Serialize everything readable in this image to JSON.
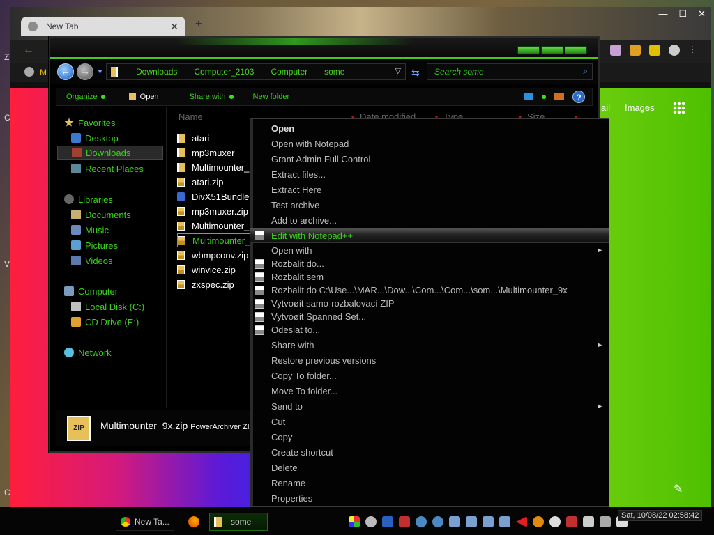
{
  "chrome": {
    "tab_title": "New Tab",
    "tab_close": "✕",
    "new_tab": "+",
    "win_min": "—",
    "win_max": "☐",
    "win_close": "✕",
    "back": "←",
    "bookmark_initial": "M",
    "gmail": "ail",
    "images": "Images",
    "pencil": "✎",
    "side_chars": [
      "Z",
      "C",
      "V",
      "C"
    ]
  },
  "explorer": {
    "breadcrumb": [
      "Downloads",
      "Computer_2103",
      "Computer",
      "some"
    ],
    "address_dropdown": "▽",
    "refresh": "⇆",
    "search_placeholder": "Search some",
    "search_icon": "⌕",
    "commands": {
      "organize": "Organize",
      "open": "Open",
      "share_with": "Share with",
      "new_folder": "New folder",
      "help": "?"
    },
    "columns": {
      "name": "Name",
      "date": "Date modified",
      "type": "Type",
      "size": "Size"
    },
    "nav": {
      "favorites": "Favorites",
      "desktop": "Desktop",
      "downloads": "Downloads",
      "recent": "Recent Places",
      "libraries": "Libraries",
      "documents": "Documents",
      "music": "Music",
      "pictures": "Pictures",
      "videos": "Videos",
      "computer": "Computer",
      "local_disk": "Local Disk (C:)",
      "cd_drive": "CD Drive (E:)",
      "network": "Network"
    },
    "files": [
      "atari",
      "mp3muxer",
      "Multimounter_",
      "atari.zip",
      "DivX51Bundle.",
      "mp3muxer.zip",
      "Multimounter_",
      "Multimounter_",
      "wbmpconv.zip",
      "winvice.zip",
      "zxspec.zip"
    ],
    "details": {
      "name": "Multimounter_9x.zip",
      "type": "PowerArchiver ZI",
      "icon_text": "ZIP"
    }
  },
  "context_menu": {
    "items": [
      "Open",
      "Open with Notepad",
      "Grant Admin Full Control",
      "Extract files...",
      "Extract Here",
      "Test archive",
      "Add to archive...",
      "Edit with Notepad++",
      "Open with",
      "Rozbalit do...",
      "Rozbalit sem",
      "Rozbalit do C:\\Use...\\MAR...\\Dow...\\Com...\\Com...\\som...\\Multimounter_9x",
      "Vytvoøit samo-rozbalovací ZIP",
      "Vytvoøit Spanned Set...",
      "Odeslat to...",
      "Share with",
      "Restore previous versions",
      "Copy To folder...",
      "Move To folder...",
      "Send to",
      "Cut",
      "Copy",
      "Create shortcut",
      "Delete",
      "Rename",
      "Properties"
    ],
    "submenu_arrow": "►"
  },
  "taskbar": {
    "chrome_label": "New Ta...",
    "explorer_label": "some",
    "clock": "Sat, 10/08/22 02:58:42"
  }
}
